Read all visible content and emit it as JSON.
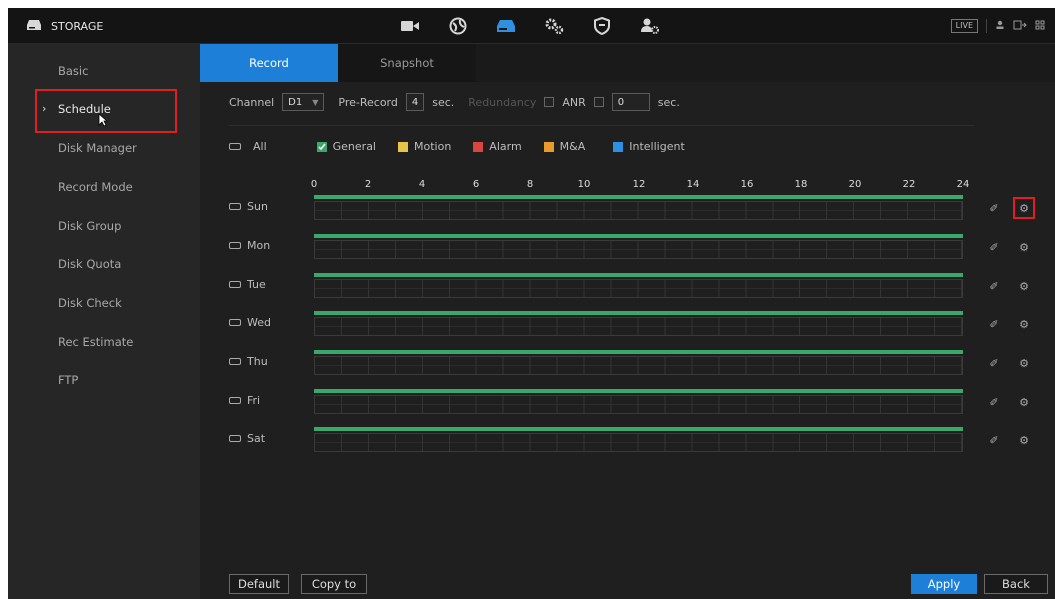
{
  "header": {
    "title": "STORAGE",
    "brand_icon": "storage-drive-icon",
    "nav_icons": [
      "camera-icon",
      "network-globe-icon",
      "storage-drive-icon",
      "settings-gears-icon",
      "security-shield-icon",
      "account-gear-icon"
    ],
    "active_nav_index": 2,
    "live_label": "LIVE",
    "tools": [
      "user-icon",
      "logout-icon",
      "grid-icon"
    ]
  },
  "sidebar": {
    "items": [
      {
        "label": "Basic"
      },
      {
        "label": "Schedule",
        "active": true
      },
      {
        "label": "Disk Manager"
      },
      {
        "label": "Record Mode"
      },
      {
        "label": "Disk Group"
      },
      {
        "label": "Disk Quota"
      },
      {
        "label": "Disk Check"
      },
      {
        "label": "Rec Estimate"
      },
      {
        "label": "FTP"
      }
    ]
  },
  "tabs": [
    {
      "label": "Record",
      "active": true
    },
    {
      "label": "Snapshot",
      "active": false
    }
  ],
  "settings": {
    "channel_label": "Channel",
    "channel_value": "D1",
    "prerecord_label": "Pre-Record",
    "prerecord_value": "4",
    "prerecord_unit": "sec.",
    "redundancy_label": "Redundancy",
    "anr_label": "ANR",
    "anr_value": "0",
    "anr_unit": "sec."
  },
  "legend": {
    "all_label": "All",
    "items": [
      {
        "label": "General",
        "color": "#3aa86a",
        "checked": true
      },
      {
        "label": "Motion",
        "color": "#e6c44a"
      },
      {
        "label": "Alarm",
        "color": "#d9463f"
      },
      {
        "label": "M&A",
        "color": "#e89a2a"
      },
      {
        "label": "Intelligent",
        "color": "#2f8fe0"
      }
    ]
  },
  "timeline": {
    "hours": [
      "0",
      "2",
      "4",
      "6",
      "8",
      "10",
      "12",
      "14",
      "16",
      "18",
      "20",
      "22",
      "24"
    ],
    "days": [
      "Sun",
      "Mon",
      "Tue",
      "Wed",
      "Thu",
      "Fri",
      "Sat"
    ],
    "schedule_color": "#3aa86a"
  },
  "buttons": {
    "default": "Default",
    "copy_to": "Copy to",
    "apply": "Apply",
    "back": "Back"
  },
  "colors": {
    "accent": "#1e7fd8",
    "highlight": "#e02020"
  }
}
